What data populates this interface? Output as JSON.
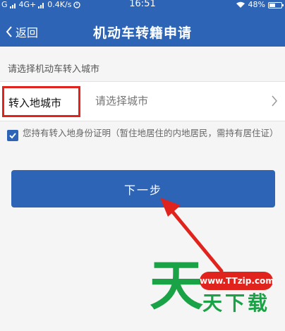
{
  "status_bar": {
    "signal_g": "G",
    "signal_4g": "4G+",
    "speed": "0.4K/s",
    "time": "16:51",
    "battery": "48%",
    "battery_level": 0.48
  },
  "header": {
    "back_label": "返回",
    "title": "机动车转籍申请",
    "color": "#2d64b5"
  },
  "form": {
    "section_label": "请选择机动车转入城市",
    "city_label": "转入地城市",
    "city_placeholder": "请选择城市",
    "consent_checked": true,
    "consent_text": "您持有转入地身份证明（暂住地居住的内地居民，需持有居住证）",
    "next_button": "下一步"
  },
  "watermark": {
    "big_char": "天",
    "url": "www.TTzip.com",
    "text": "天下载"
  },
  "colors": {
    "accent": "#2d64b5",
    "highlight": "#e0231c",
    "watermark_green": "#1aa246"
  }
}
